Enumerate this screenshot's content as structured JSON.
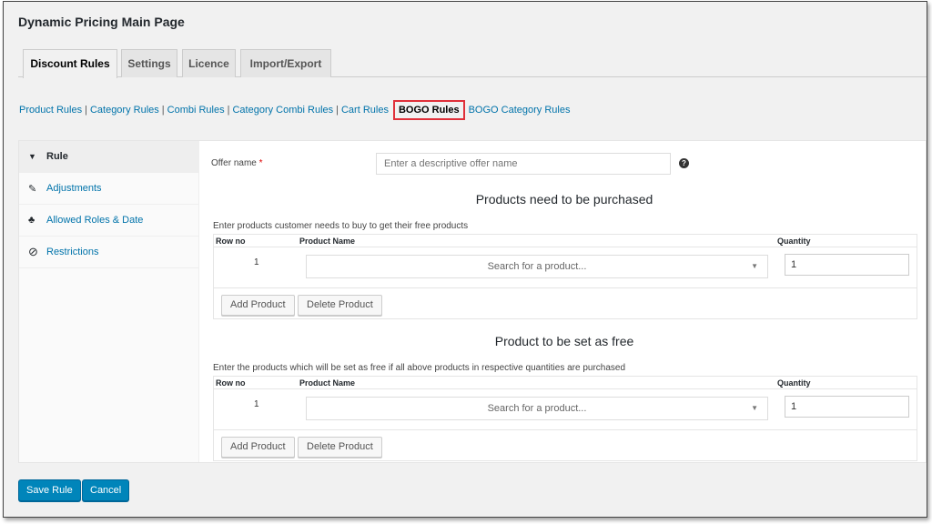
{
  "page_title": "Dynamic Pricing Main Page",
  "tabs": [
    {
      "label": "Discount Rules",
      "active": true
    },
    {
      "label": "Settings",
      "active": false
    },
    {
      "label": "Licence",
      "active": false
    },
    {
      "label": "Import/Export",
      "active": false
    }
  ],
  "subnav": {
    "links": [
      "Product Rules",
      "Category Rules",
      "Combi Rules",
      "Category Combi Rules",
      "Cart Rules",
      "BOGO Rules",
      "BOGO Category Rules"
    ],
    "separator": "|",
    "current": "BOGO Rules"
  },
  "sidebar": {
    "items": [
      {
        "label": "Rule",
        "icon": "funnel-icon",
        "glyph": "▼",
        "active": true
      },
      {
        "label": "Adjustments",
        "icon": "pencil-icon",
        "glyph": "✎",
        "active": false
      },
      {
        "label": "Allowed Roles & Date",
        "icon": "users-icon",
        "glyph": "♣",
        "active": false
      },
      {
        "label": "Restrictions",
        "icon": "ban-icon",
        "glyph": "⊘",
        "active": false
      }
    ]
  },
  "form": {
    "offer_label": "Offer name",
    "required_mark": "*",
    "offer_placeholder": "Enter a descriptive offer name",
    "help_glyph": "?"
  },
  "purchase_section": {
    "title": "Products need to be purchased",
    "description": "Enter products customer needs to buy to get their free products",
    "headers": {
      "row_no": "Row no",
      "product": "Product Name",
      "quantity": "Quantity"
    },
    "row": {
      "num": "1",
      "product_placeholder": "Search for a product...",
      "quantity": "1"
    },
    "add_label": "Add Product",
    "delete_label": "Delete Product"
  },
  "free_section": {
    "title": "Product to be set as free",
    "description": "Enter the products which will be set as free if all above products in respective quantities are purchased",
    "headers": {
      "row_no": "Row no",
      "product": "Product Name",
      "quantity": "Quantity"
    },
    "row": {
      "num": "1",
      "product_placeholder": "Search for a product...",
      "quantity": "1"
    },
    "add_label": "Add Product",
    "delete_label": "Delete Product"
  },
  "footer": {
    "save_label": "Save Rule",
    "cancel_label": "Cancel"
  },
  "colors": {
    "link": "#0073aa",
    "primary_button": "#0085ba",
    "highlight_border": "#e0303a"
  }
}
